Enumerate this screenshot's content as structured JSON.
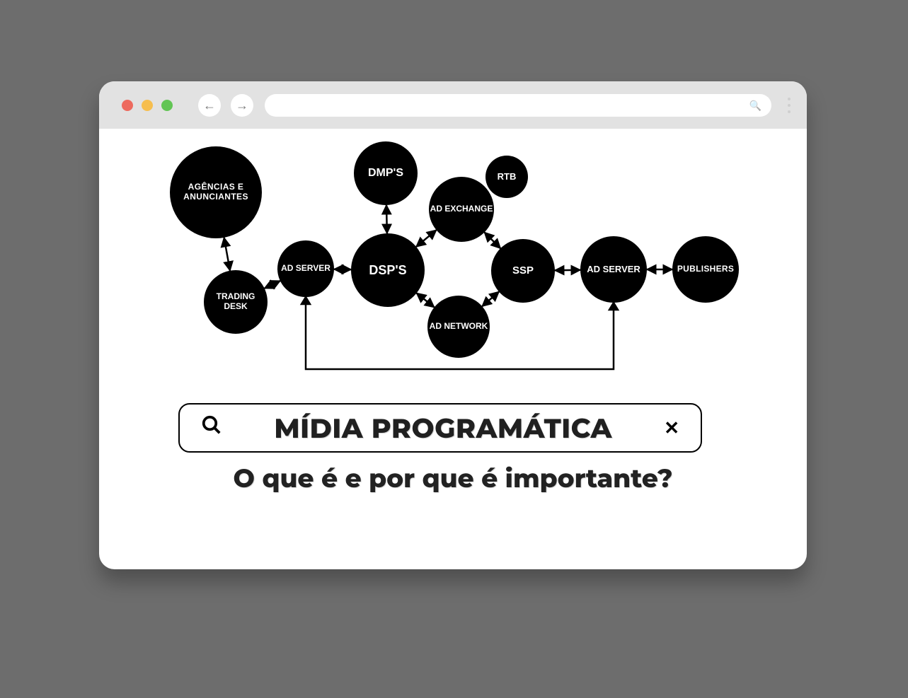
{
  "browser": {
    "back_glyph": "←",
    "fwd_glyph": "→",
    "search_glyph": "🔍"
  },
  "diagram": {
    "nodes": {
      "agencias": "AGÊNCIAS E ANUNCIANTES",
      "trading": "TRADING DESK",
      "adserver1": "AD SERVER",
      "dmps": "DMP'S",
      "dsps": "DSP'S",
      "adex": "AD EXCHANGE",
      "rtb": "RTB",
      "adnet": "AD NETWORK",
      "ssp": "SSP",
      "adserver2": "AD SERVER",
      "pubs": "PUBLISHERS"
    },
    "edges": [
      [
        "agencias",
        "trading",
        "bi"
      ],
      [
        "trading",
        "adserver1",
        "bi"
      ],
      [
        "adserver1",
        "dsps",
        "bi"
      ],
      [
        "dmps",
        "dsps",
        "bi"
      ],
      [
        "dsps",
        "adex",
        "bi"
      ],
      [
        "dsps",
        "adnet",
        "bi"
      ],
      [
        "adex",
        "ssp",
        "bi"
      ],
      [
        "adnet",
        "ssp",
        "bi"
      ],
      [
        "ssp",
        "adserver2",
        "bi"
      ],
      [
        "adserver2",
        "pubs",
        "bi"
      ]
    ],
    "through_line": {
      "from": "adserver1",
      "to": "adserver2"
    }
  },
  "search": {
    "term": "MÍDIA PROGRAMÁTICA",
    "mag_glyph": "🔍",
    "close_glyph": "✕"
  },
  "subtitle": "O que é e por que é importante?"
}
